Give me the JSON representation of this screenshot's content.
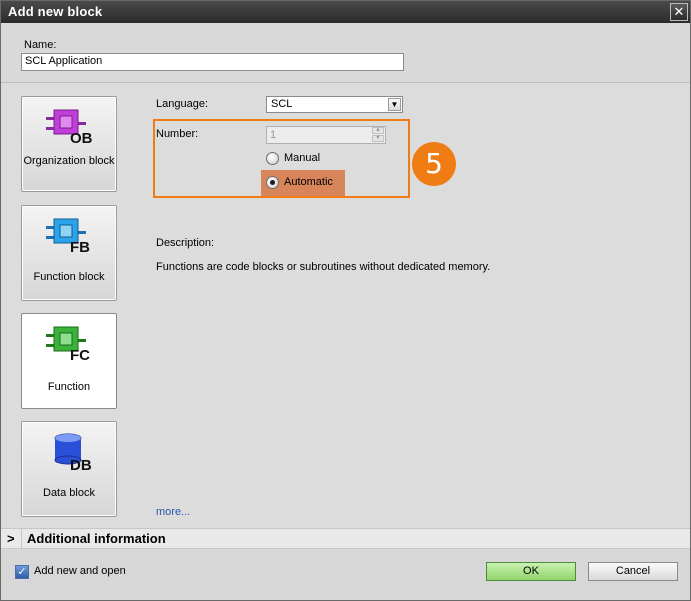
{
  "window": {
    "title": "Add new block",
    "close_glyph": "✕"
  },
  "name": {
    "label": "Name:",
    "value": "SCL Application"
  },
  "block_types": [
    {
      "label": "Organization block",
      "badge": "OB",
      "icon": "organization-block-icon",
      "color": "#c03fd8"
    },
    {
      "label": "Function block",
      "badge": "FB",
      "icon": "function-block-icon",
      "color": "#2aa3ea"
    },
    {
      "label": "Function",
      "badge": "FC",
      "icon": "function-icon",
      "color": "#3bb33b",
      "selected": true
    },
    {
      "label": "Data block",
      "badge": "DB",
      "icon": "data-block-icon",
      "color": "#2a4fd8"
    }
  ],
  "language": {
    "label": "Language:",
    "value": "SCL"
  },
  "number": {
    "label": "Number:",
    "value": "1"
  },
  "numbering": {
    "manual_label": "Manual",
    "automatic_label": "Automatic",
    "selected": "Automatic"
  },
  "callout": {
    "step": "5",
    "color": "#f07d13"
  },
  "description": {
    "label": "Description:",
    "text": "Functions are code blocks or subroutines without dedicated memory."
  },
  "more_link": "more...",
  "additional_info": {
    "label": "Additional information",
    "chevron": ">"
  },
  "footer": {
    "add_new_and_open_label": "Add new and open",
    "add_new_and_open_checked": true,
    "ok_label": "OK",
    "cancel_label": "Cancel"
  }
}
